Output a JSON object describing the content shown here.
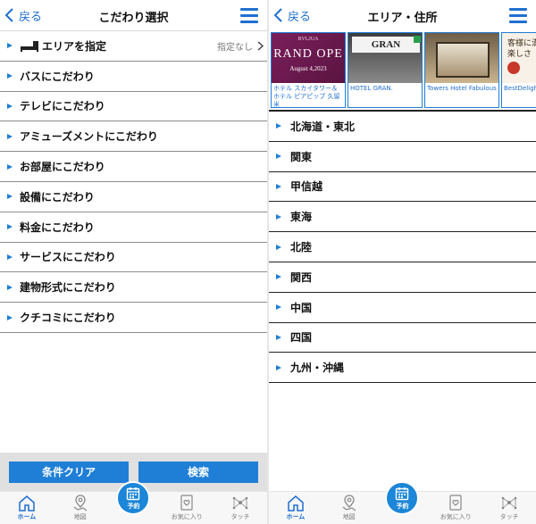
{
  "left": {
    "header": {
      "back_label": "戻る",
      "title": "こだわり選択"
    },
    "area_row": {
      "label": "エリアを指定",
      "value": "指定なし"
    },
    "items": [
      "バスにこだわり",
      "テレビにこだわり",
      "アミューズメントにこだわり",
      "お部屋にこだわり",
      "設備にこだわり",
      "料金にこだわり",
      "サービスにこだわり",
      "建物形式にこだわり",
      "クチコミにこだわり"
    ],
    "buttons": {
      "clear": "条件クリア",
      "search": "検索"
    }
  },
  "right": {
    "header": {
      "back_label": "戻る",
      "title": "エリア・住所"
    },
    "banners": [
      {
        "img_line1": "BVLJUA",
        "img_line2": "RAND OPE",
        "img_line3": "August 4,2023",
        "caption": "ホテル スカイタワー＆ホテル ピアピッブ 久留米"
      },
      {
        "img_line1": "GRAN",
        "caption": "HOTEL GRAN."
      },
      {
        "caption": "Towers Hotel Fabulous"
      },
      {
        "img_line1": "客様に満",
        "img_line2": "楽しさ",
        "caption": "BestDeligh"
      }
    ],
    "regions": [
      "北海道・東北",
      "関東",
      "甲信越",
      "東海",
      "北陸",
      "関西",
      "中国",
      "四国",
      "九州・沖縄"
    ]
  },
  "tabbar": {
    "tabs": [
      {
        "label": "ホーム",
        "icon": "home-icon",
        "active": true
      },
      {
        "label": "地図",
        "icon": "map-icon",
        "active": false
      },
      {
        "label": "予約",
        "icon": "calendar-icon",
        "active": false
      },
      {
        "label": "お気に入り",
        "icon": "heart-card-icon",
        "active": false
      },
      {
        "label": "タッチ",
        "icon": "touch-network-icon",
        "active": false
      }
    ]
  },
  "colors": {
    "accent": "#1f6fd0",
    "button": "#1f7fd6",
    "reserve": "#1c86d8"
  }
}
